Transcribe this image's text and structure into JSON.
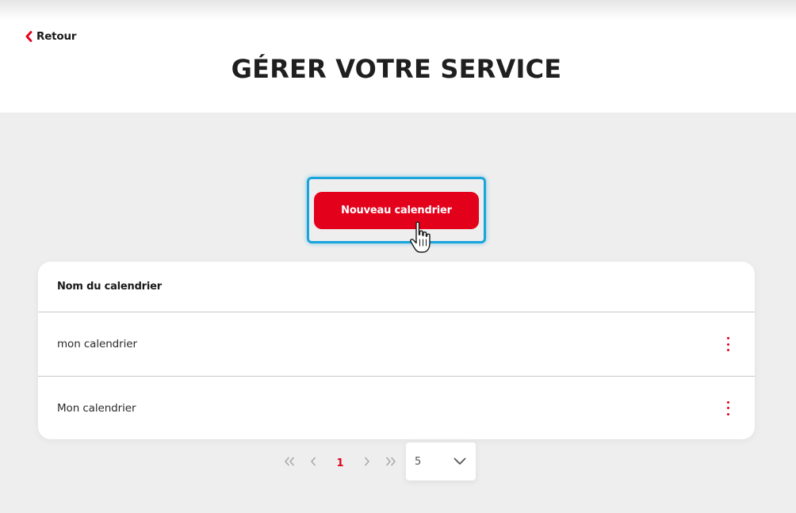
{
  "header": {
    "back_label": "Retour",
    "title": "GÉRER VOTRE SERVICE"
  },
  "actions": {
    "new_calendar_label": "Nouveau calendrier"
  },
  "table": {
    "column_header": "Nom du calendrier",
    "rows": [
      {
        "name": "mon calendrier"
      },
      {
        "name": "Mon calendrier"
      }
    ]
  },
  "pagination": {
    "current_page": "1",
    "page_size": "5"
  },
  "colors": {
    "accent": "#e3001b",
    "focus_ring": "#1aa4dc",
    "background": "#eeeeee"
  },
  "icons": {
    "back": "chevron-left-icon",
    "row_menu": "more-vertical-icon",
    "first": "chevrons-left-icon",
    "prev": "chevron-left-icon",
    "next": "chevron-right-icon",
    "last": "chevrons-right-icon",
    "dropdown": "chevron-down-icon",
    "pointer": "hand-pointer-icon"
  }
}
